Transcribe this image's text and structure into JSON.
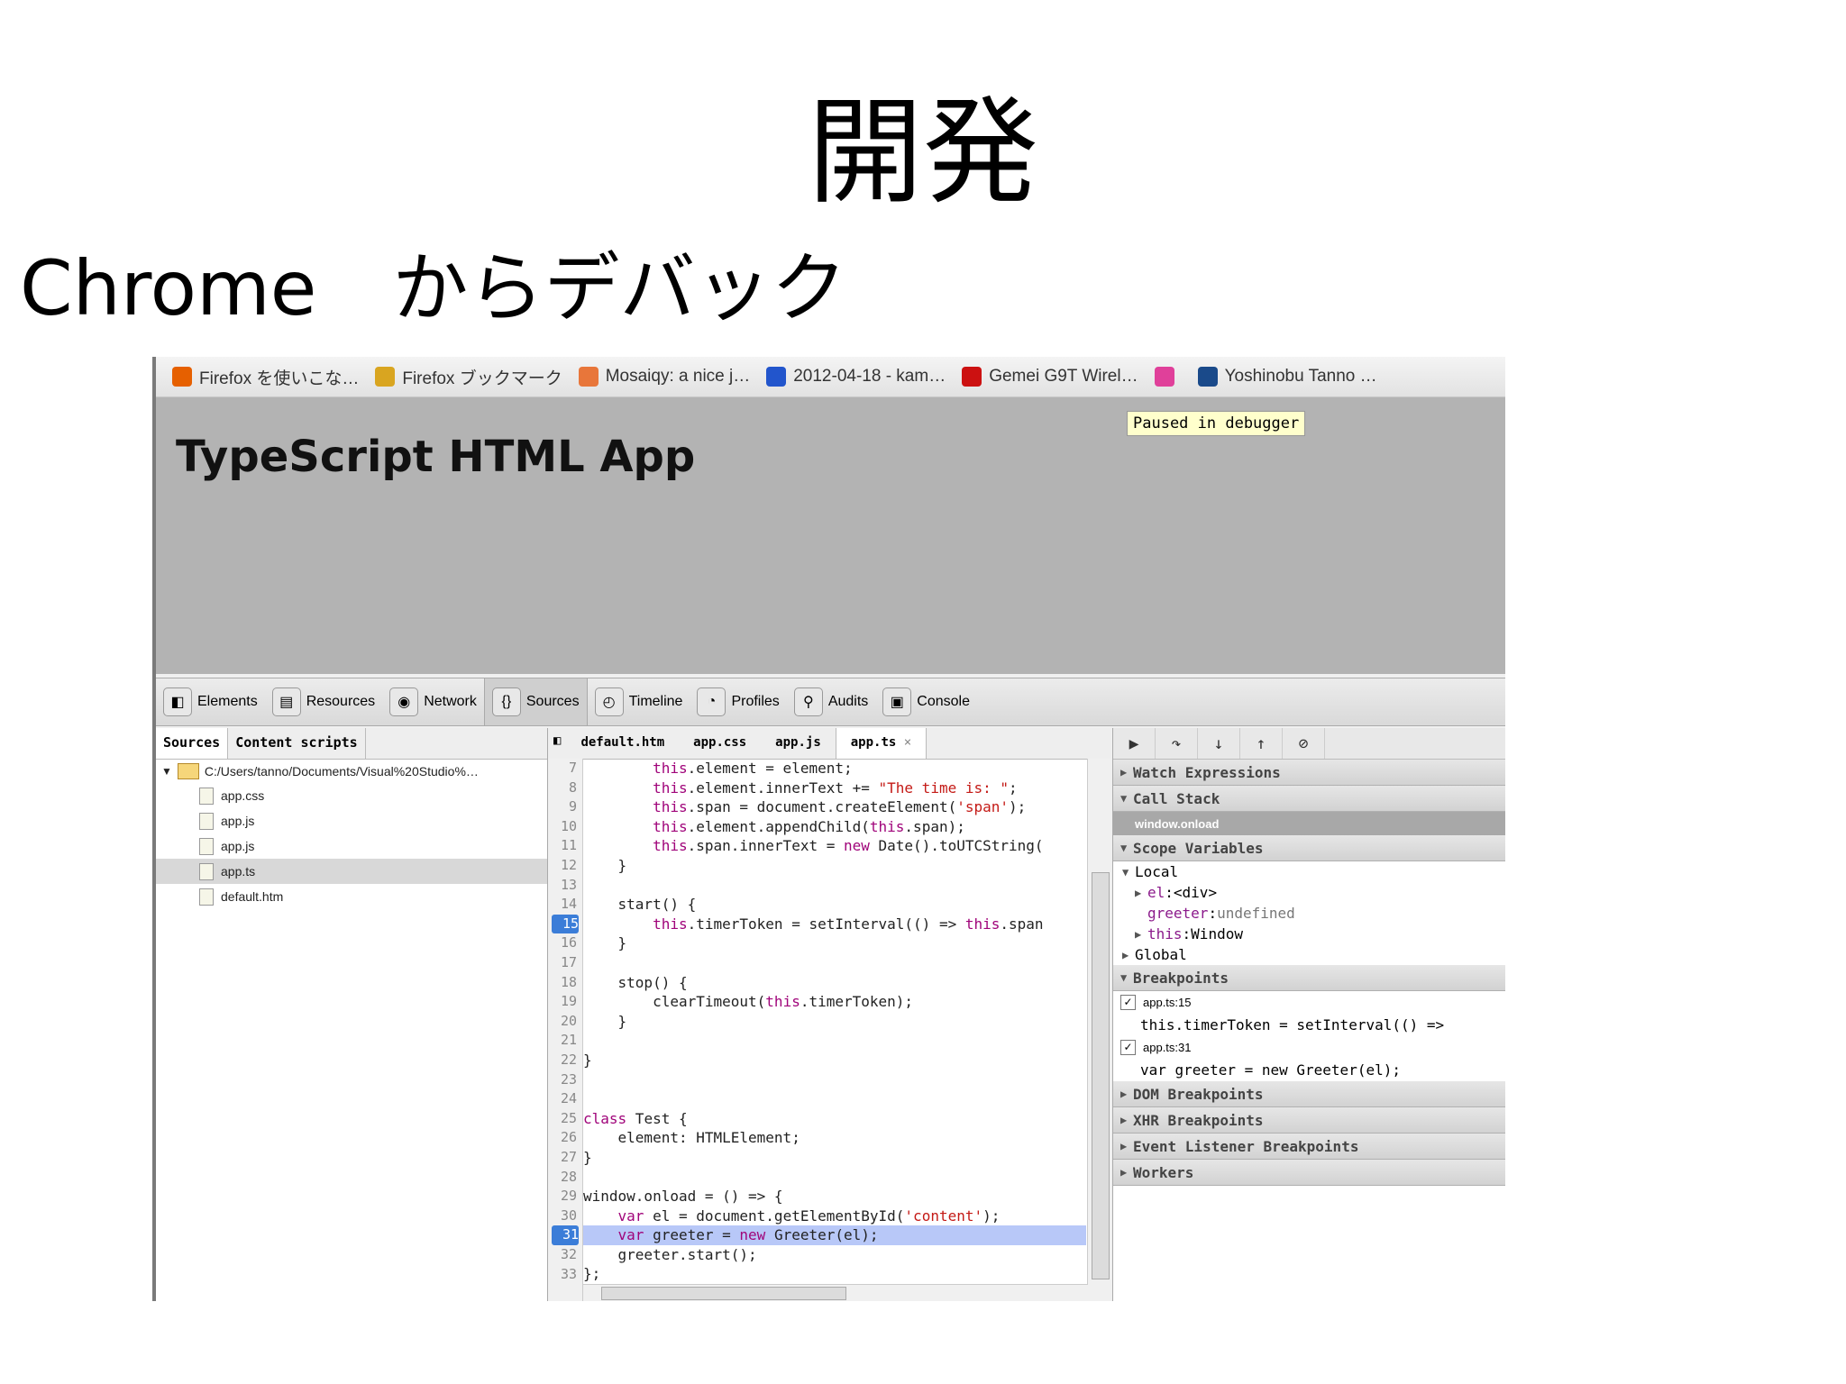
{
  "slide": {
    "title": "開発",
    "subtitle": "Chrome　からデバック"
  },
  "bookmarks": [
    {
      "label": "Firefox を使いこな…",
      "icon": "firefox-icon",
      "color": "#e66000"
    },
    {
      "label": "Firefox ブックマーク",
      "icon": "folder-icon",
      "color": "#d9a520"
    },
    {
      "label": "Mosaiqy: a nice j…",
      "icon": "mosaiqy-icon",
      "color": "#e8763a"
    },
    {
      "label": "2012-04-18 - kam…",
      "icon": "d-icon",
      "color": "#2255cc"
    },
    {
      "label": "Gemei G9T Wirel…",
      "icon": "youtube-icon",
      "color": "#cc1111"
    },
    {
      "label": "",
      "icon": "pink-icon",
      "color": "#e0409a"
    },
    {
      "label": "Yoshinobu Tanno …",
      "icon": "me-icon",
      "color": "#1a4a8a"
    }
  ],
  "page": {
    "heading": "TypeScript HTML App",
    "paused": "Paused in debugger"
  },
  "devtools_tabs": [
    {
      "label": "Elements",
      "icon": "elements-icon"
    },
    {
      "label": "Resources",
      "icon": "resources-icon"
    },
    {
      "label": "Network",
      "icon": "network-icon"
    },
    {
      "label": "Sources",
      "icon": "sources-icon",
      "active": true
    },
    {
      "label": "Timeline",
      "icon": "timeline-icon"
    },
    {
      "label": "Profiles",
      "icon": "profiles-icon"
    },
    {
      "label": "Audits",
      "icon": "audits-icon"
    },
    {
      "label": "Console",
      "icon": "console-icon"
    }
  ],
  "navigator": {
    "tabs": [
      "Sources",
      "Content scripts"
    ],
    "root": "C:/Users/tanno/Documents/Visual%20Studio%…",
    "files": [
      "app.css",
      "app.js",
      "app.js",
      "app.ts",
      "default.htm"
    ],
    "selected_index": 3
  },
  "editor": {
    "tabs": [
      "default.htm",
      "app.css",
      "app.js",
      "app.ts"
    ],
    "active_tab": "app.ts",
    "lines": [
      {
        "n": "7",
        "code": "        this.element = element;"
      },
      {
        "n": "8",
        "code": "        this.element.innerText += \"The time is: \";"
      },
      {
        "n": "9",
        "code": "        this.span = document.createElement('span');"
      },
      {
        "n": "10",
        "code": "        this.element.appendChild(this.span);"
      },
      {
        "n": "11",
        "code": "        this.span.innerText = new Date().toUTCString("
      },
      {
        "n": "12",
        "code": "    }"
      },
      {
        "n": "13",
        "code": ""
      },
      {
        "n": "14",
        "code": "    start() {"
      },
      {
        "n": "15",
        "code": "        this.timerToken = setInterval(() => this.span",
        "breakpoint": true
      },
      {
        "n": "16",
        "code": "    }"
      },
      {
        "n": "17",
        "code": ""
      },
      {
        "n": "18",
        "code": "    stop() {"
      },
      {
        "n": "19",
        "code": "        clearTimeout(this.timerToken);"
      },
      {
        "n": "20",
        "code": "    }"
      },
      {
        "n": "21",
        "code": ""
      },
      {
        "n": "22",
        "code": "}"
      },
      {
        "n": "23",
        "code": ""
      },
      {
        "n": "24",
        "code": ""
      },
      {
        "n": "25",
        "code": "class Test {"
      },
      {
        "n": "26",
        "code": "    element: HTMLElement;"
      },
      {
        "n": "27",
        "code": "}"
      },
      {
        "n": "28",
        "code": ""
      },
      {
        "n": "29",
        "code": "window.onload = () => {"
      },
      {
        "n": "30",
        "code": "    var el = document.getElementById('content');"
      },
      {
        "n": "31",
        "code": "    var greeter = new Greeter(el);",
        "breakpoint": true,
        "execution": true
      },
      {
        "n": "32",
        "code": "    greeter.start();"
      },
      {
        "n": "33",
        "code": "};"
      }
    ]
  },
  "sidebar": {
    "watch": "Watch Expressions",
    "call_stack": "Call Stack",
    "call_frame": "window.onload",
    "scope": "Scope Variables",
    "local": "Local",
    "local_vars": [
      {
        "name": "el",
        "sep": ": ",
        "value": "<div>",
        "expandable": true
      },
      {
        "name": "greeter",
        "sep": ": ",
        "value": "undefined",
        "expandable": false
      },
      {
        "name": "this",
        "sep": ": ",
        "value": "Window",
        "expandable": true
      }
    ],
    "global": "Global",
    "breakpoints": "Breakpoints",
    "breakpoint_items": [
      {
        "location": "app.ts:15",
        "code": "this.timerToken = setInterval(() =>"
      },
      {
        "location": "app.ts:31",
        "code": "var greeter = new Greeter(el);"
      }
    ],
    "dom_breakpoints": "DOM Breakpoints",
    "xhr_breakpoints": "XHR Breakpoints",
    "event_breakpoints": "Event Listener Breakpoints",
    "workers": "Workers"
  }
}
